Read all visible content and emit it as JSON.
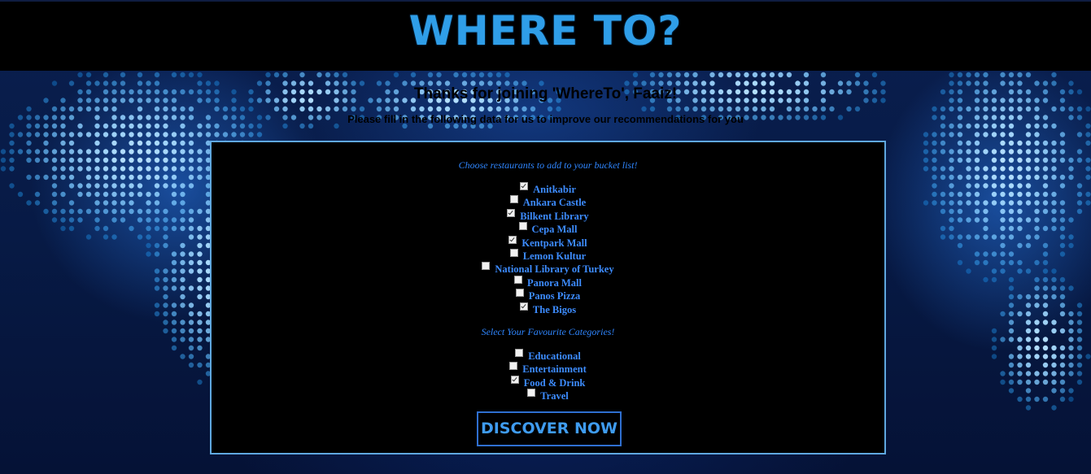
{
  "header": {
    "logo_text": "WHERE TO?"
  },
  "welcome": {
    "thanks": "Thanks for joining 'WhereTo', Faaiz!",
    "subtitle": "Please fill in the following data for us to improve our recommendations for you"
  },
  "restaurants": {
    "title": "Choose restaurants to add to your bucket list!",
    "options": [
      {
        "label": "Anitkabir",
        "checked": true
      },
      {
        "label": "Ankara Castle",
        "checked": false
      },
      {
        "label": "Bilkent Library",
        "checked": true
      },
      {
        "label": "Cepa Mall",
        "checked": false
      },
      {
        "label": "Kentpark Mall",
        "checked": true
      },
      {
        "label": "Lemon Kultur",
        "checked": false
      },
      {
        "label": "National Library of Turkey",
        "checked": false
      },
      {
        "label": "Panora Mall",
        "checked": false
      },
      {
        "label": "Panos Pizza",
        "checked": false
      },
      {
        "label": "The Bigos",
        "checked": true
      }
    ]
  },
  "categories": {
    "title": "Select Your Favourite Categories!",
    "options": [
      {
        "label": "Educational",
        "checked": false
      },
      {
        "label": "Entertainment",
        "checked": false
      },
      {
        "label": "Food & Drink",
        "checked": true
      },
      {
        "label": "Travel",
        "checked": false
      }
    ]
  },
  "form": {
    "submit_label": "DISCOVER NOW"
  },
  "colors": {
    "accent": "#2f86ff",
    "logo": "#2f9ee8",
    "form_border": "#5fa8e0"
  }
}
